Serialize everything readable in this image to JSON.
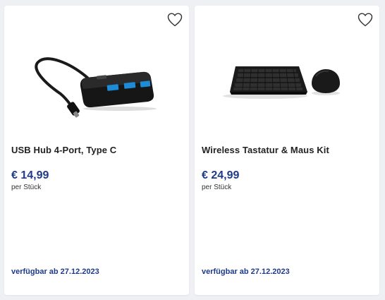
{
  "products": [
    {
      "title": "USB Hub 4-Port, Type C",
      "price": "€ 14,99",
      "unit": "per Stück",
      "availability": "verfügbar ab 27.12.2023"
    },
    {
      "title": "Wireless Tastatur & Maus Kit",
      "price": "€ 24,99",
      "unit": "per Stück",
      "availability": "verfügbar ab 27.12.2023"
    }
  ],
  "colors": {
    "accent": "#1e3a8a",
    "card_bg": "#ffffff",
    "page_bg": "#eef0f4"
  },
  "icons": {
    "wishlist": "heart-icon"
  }
}
